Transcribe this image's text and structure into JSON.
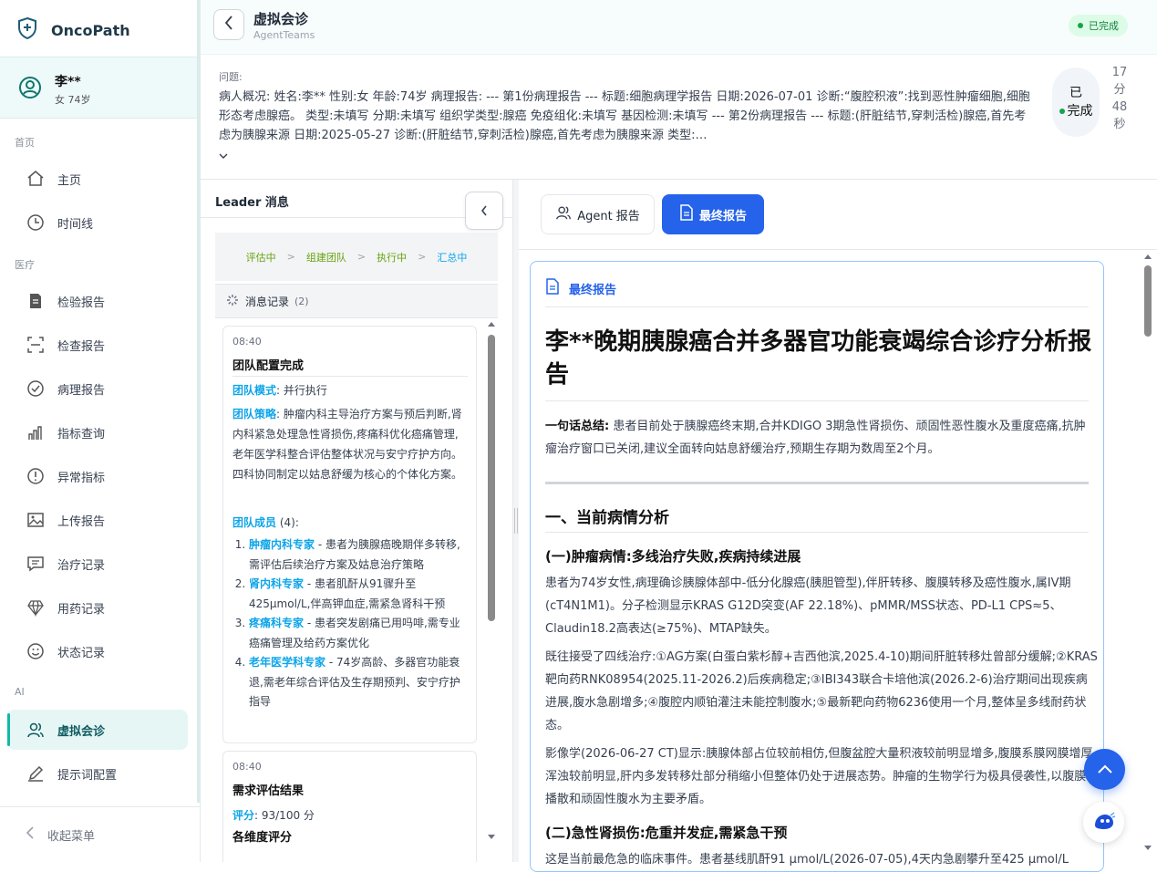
{
  "app": {
    "brand": "OncoPath"
  },
  "patient": {
    "name": "李**",
    "info": "女 74岁"
  },
  "sidebar": {
    "sections": [
      "首页",
      "医疗",
      "AI"
    ],
    "items": [
      {
        "label": "主页",
        "icon": "home-icon"
      },
      {
        "label": "时间线",
        "icon": "clock-icon"
      },
      {
        "label": "检验报告",
        "icon": "document-icon"
      },
      {
        "label": "检查报告",
        "icon": "scan-icon"
      },
      {
        "label": "病理报告",
        "icon": "check-circle-icon"
      },
      {
        "label": "指标查询",
        "icon": "bar-chart-icon"
      },
      {
        "label": "异常指标",
        "icon": "alert-circle-icon"
      },
      {
        "label": "上传报告",
        "icon": "image-icon"
      },
      {
        "label": "治疗记录",
        "icon": "message-icon"
      },
      {
        "label": "用药记录",
        "icon": "diamond-icon"
      },
      {
        "label": "状态记录",
        "icon": "smile-icon"
      },
      {
        "label": "虚拟会诊",
        "icon": "users-icon"
      },
      {
        "label": "提示词配置",
        "icon": "pen-icon"
      }
    ],
    "collapse_label": "收起菜单"
  },
  "header": {
    "title": "虚拟会诊",
    "subtitle": "AgentTeams",
    "status": "已完成"
  },
  "question": {
    "label": "问题:",
    "text": "病人概况: 姓名:李** 性别:女 年龄:74岁 病理报告: --- 第1份病理报告 --- 标题:细胞病理学报告 日期:2026-07-01 诊断:“腹腔积液”:找到恶性肿瘤细胞,细胞形态考虑腺癌。 类型:未填写 分期:未填写 组织学类型:腺癌 免疫组化:未填写 基因检测:未填写 --- 第2份病理报告 --- 标题:(肝脏结节,穿刺活检)腺癌,首先考虑为胰腺来源 日期:2025-05-27 诊断:(肝脏结节,穿刺活检)腺癌,首先考虑为胰腺来源 类型:…",
    "status_line1": "已",
    "status_line2": "完成",
    "elapsed": [
      "17",
      "分",
      "48",
      "秒"
    ]
  },
  "leader": {
    "title": "Leader 消息",
    "steps": [
      "评估中",
      "组建团队",
      "执行中",
      "汇总中"
    ],
    "log_title": "消息记录",
    "log_count": "(2)",
    "cards": [
      {
        "time": "08:40",
        "title": "团队配置完成",
        "mode_label": "团队模式",
        "mode_value": ": 并行执行",
        "strategy_label": "团队策略",
        "strategy_value": ": 肿瘤内科主导治疗方案与预后判断,肾内科紧急处理急性肾损伤,疼痛科优化癌痛管理,老年医学科整合评估整体状况与安宁疗护方向。四科协同制定以姑息舒缓为核心的个体化方案。",
        "members_label": "团队成员",
        "members_count": " (4):",
        "members": [
          {
            "name": "肿瘤内科专家",
            "desc": " - 患者为胰腺癌晚期伴多转移,需评估后续治疗方案及姑息治疗策略"
          },
          {
            "name": "肾内科专家",
            "desc": " - 患者肌酐从91骤升至425μmol/L,伴高钾血症,需紧急肾科干预"
          },
          {
            "name": "疼痛科专家",
            "desc": " - 患者突发剧痛已用吗啡,需专业癌痛管理及给药方案优化"
          },
          {
            "name": "老年医学科专家",
            "desc": " - 74岁高龄、多器官功能衰退,需老年综合评估及生存期预判、安宁疗护指导"
          }
        ]
      },
      {
        "time": "08:40",
        "title": "需求评估结果",
        "score_label": "评分",
        "score_value": ": 93/100 分",
        "dims_title": "各维度评分"
      }
    ]
  },
  "tabs": {
    "agent": "Agent 报告",
    "final": "最终报告"
  },
  "report": {
    "header": "最终报告",
    "title": "李**晚期胰腺癌合并多器官功能衰竭综合诊疗分析报告",
    "summary_label": "一句话总结:",
    "summary": " 患者目前处于胰腺癌终末期,合并KDIGO 3期急性肾损伤、顽固性恶性腹水及重度癌痛,抗肿瘤治疗窗口已关闭,建议全面转向姑息舒缓治疗,预期生存期为数周至2个月。",
    "h2": "一、当前病情分析",
    "h3a": "(一)肿瘤病情:多线治疗失败,疾病持续进展",
    "p1": "患者为74岁女性,病理确诊胰腺体部中-低分化腺癌(胰胆管型),伴肝转移、腹膜转移及癌性腹水,属IV期(cT4N1M1)。分子检测显示KRAS G12D突变(AF 22.18%)、pMMR/MSS状态、PD-L1 CPS≈5、Claudin18.2高表达(≥75%)、MTAP缺失。",
    "p2": "既往接受了四线治疗:①AG方案(白蛋白紫杉醇+吉西他滨,2025.4-10)期间肝脏转移灶曾部分缓解;②KRAS靶向药RNK08954(2025.11-2026.2)后疾病稳定;③IBI343联合卡培他滨(2026.2-6)治疗期间出现疾病进展,腹水急剧增多;④腹腔内顺铂灌注未能控制腹水;⑤最新靶向药物6236使用一个月,整体呈多线耐药状态。",
    "p3": "影像学(2026-06-27 CT)显示:胰腺体部占位较前相仿,但腹盆腔大量积液较前明显增多,腹膜系膜网膜增厚浑浊较前明显,肝内多发转移灶部分稍缩小但整体仍处于进展态势。肿瘤的生物学行为极具侵袭性,以腹膜播散和顽固性腹水为主要矛盾。",
    "h3b": "(二)急性肾损伤:危重并发症,需紧急干预",
    "p4": "这是当前最危急的临床事件。患者基线肌酐91 μmol/L(2026-07-05),4天内急剧攀升至425 μmol/L"
  },
  "colors": {
    "accent": "#2563eb",
    "teal": "#14b8a6",
    "success": "#16a34a"
  }
}
